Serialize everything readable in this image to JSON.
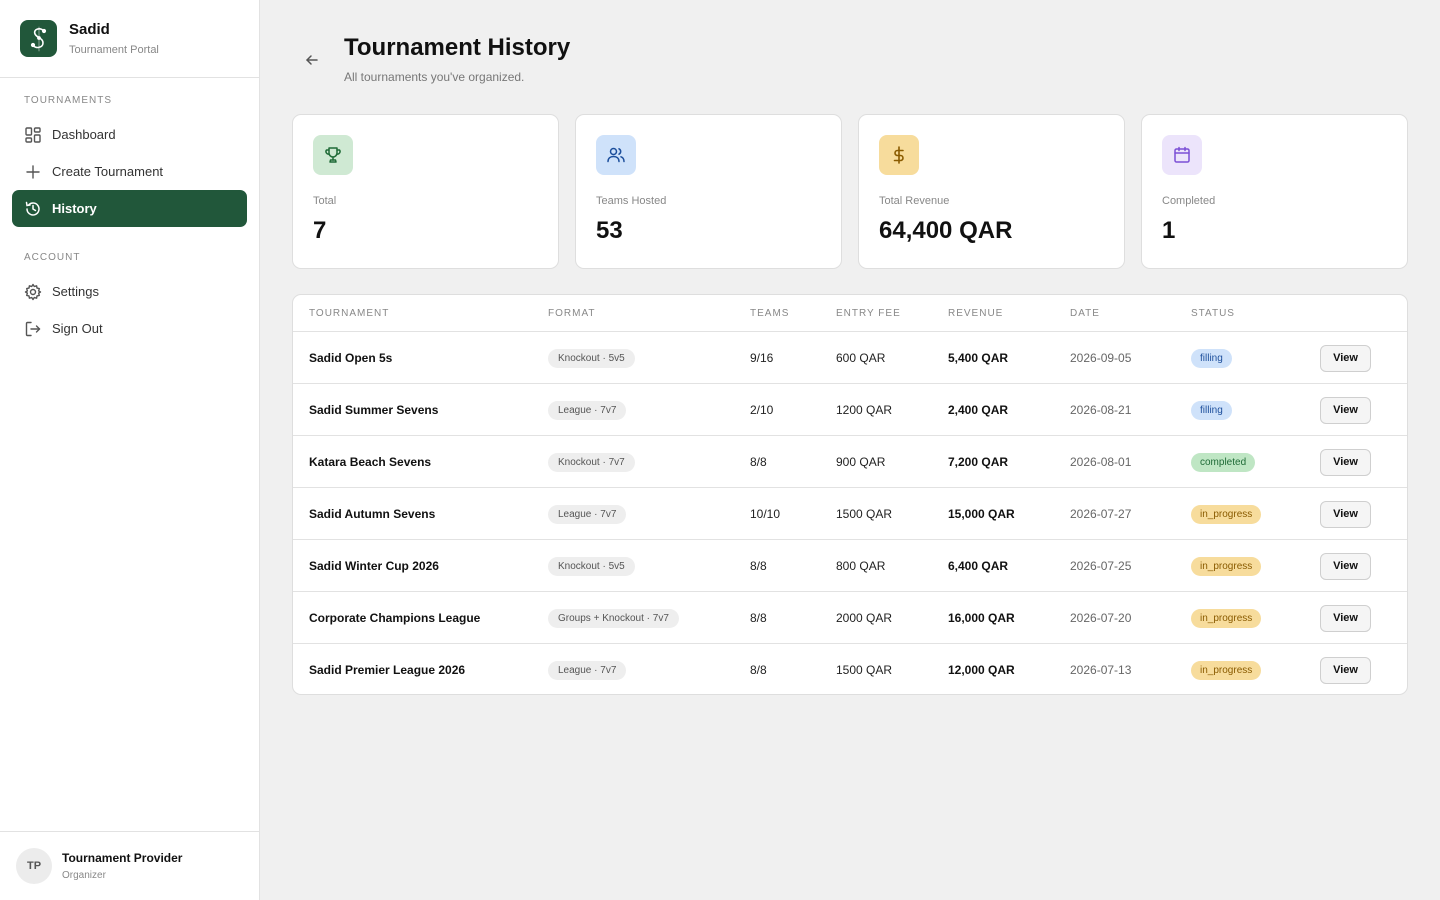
{
  "brand": {
    "name": "Sadid",
    "subtitle": "Tournament Portal"
  },
  "sidebar": {
    "sections": [
      {
        "label": "TOURNAMENTS"
      },
      {
        "label": "ACCOUNT"
      }
    ],
    "items": [
      {
        "label": "Dashboard",
        "icon": "dashboard-grid-icon"
      },
      {
        "label": "Create Tournament",
        "icon": "plus-icon"
      },
      {
        "label": "History",
        "icon": "history-icon",
        "active": true
      },
      {
        "label": "Settings",
        "icon": "gear-icon"
      },
      {
        "label": "Sign Out",
        "icon": "sign-out-icon"
      }
    ]
  },
  "user": {
    "initials": "TP",
    "name": "Tournament Provider",
    "role": "Organizer"
  },
  "header": {
    "title": "Tournament History",
    "subtitle": "All tournaments you've organized."
  },
  "stats": [
    {
      "label": "Total",
      "value": "7",
      "icon": "trophy-icon",
      "bg": "#cfe9d3",
      "fg": "#1f6b37"
    },
    {
      "label": "Teams Hosted",
      "value": "53",
      "icon": "users-icon",
      "bg": "#cfe2fa",
      "fg": "#1d4f9c"
    },
    {
      "label": "Total Revenue",
      "value": "64,400 QAR",
      "icon": "dollar-icon",
      "bg": "#f7dc9c",
      "fg": "#8a5b00"
    },
    {
      "label": "Completed",
      "value": "1",
      "icon": "calendar-icon",
      "bg": "#ece4fb",
      "fg": "#7b4fd6"
    }
  ],
  "table": {
    "headers": [
      "TOURNAMENT",
      "FORMAT",
      "TEAMS",
      "ENTRY FEE",
      "REVENUE",
      "DATE",
      "STATUS"
    ],
    "view_label": "View",
    "rows": [
      {
        "name": "Sadid Open 5s",
        "format": "Knockout · 5v5",
        "teams": "9/16",
        "fee": "600 QAR",
        "revenue": "5,400 QAR",
        "date": "2026-09-05",
        "status": "filling"
      },
      {
        "name": "Sadid Summer Sevens",
        "format": "League · 7v7",
        "teams": "2/10",
        "fee": "1200 QAR",
        "revenue": "2,400 QAR",
        "date": "2026-08-21",
        "status": "filling"
      },
      {
        "name": "Katara Beach Sevens",
        "format": "Knockout · 7v7",
        "teams": "8/8",
        "fee": "900 QAR",
        "revenue": "7,200 QAR",
        "date": "2026-08-01",
        "status": "completed"
      },
      {
        "name": "Sadid Autumn Sevens",
        "format": "League · 7v7",
        "teams": "10/10",
        "fee": "1500 QAR",
        "revenue": "15,000 QAR",
        "date": "2026-07-27",
        "status": "in_progress"
      },
      {
        "name": "Sadid Winter Cup 2026",
        "format": "Knockout · 5v5",
        "teams": "8/8",
        "fee": "800 QAR",
        "revenue": "6,400 QAR",
        "date": "2026-07-25",
        "status": "in_progress"
      },
      {
        "name": "Corporate Champions League",
        "format": "Groups + Knockout · 7v7",
        "teams": "8/8",
        "fee": "2000 QAR",
        "revenue": "16,000 QAR",
        "date": "2026-07-20",
        "status": "in_progress"
      },
      {
        "name": "Sadid Premier League 2026",
        "format": "League · 7v7",
        "teams": "8/8",
        "fee": "1500 QAR",
        "revenue": "12,000 QAR",
        "date": "2026-07-13",
        "status": "in_progress"
      }
    ]
  },
  "status_colors": {
    "filling": {
      "bg": "#cfe2fa",
      "fg": "#1d4f9c"
    },
    "completed": {
      "bg": "#bfe6c4",
      "fg": "#1f6b37"
    },
    "in_progress": {
      "bg": "#f7dc9c",
      "fg": "#8a5b00"
    }
  },
  "accent_color": "#21573a"
}
